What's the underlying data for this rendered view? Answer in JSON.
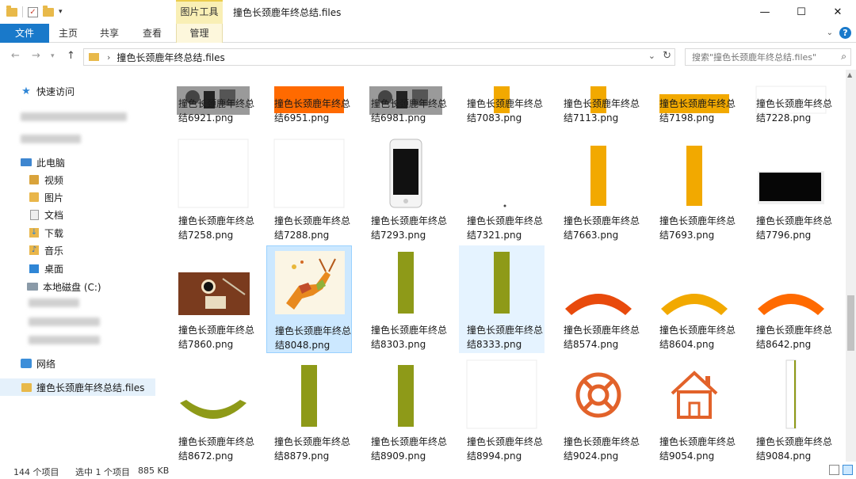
{
  "window": {
    "context_tab": "图片工具",
    "title": "撞色长颈鹿年终总结.files"
  },
  "ribbon": {
    "tabs": [
      "文件",
      "主页",
      "共享",
      "查看",
      "管理"
    ]
  },
  "address": {
    "crumb": "撞色长颈鹿年终总结.files",
    "search_placeholder": "搜索\"撞色长颈鹿年终总结.files\""
  },
  "sidebar": {
    "quick_access": "快速访问",
    "this_pc": "此电脑",
    "pc_items": [
      "视频",
      "图片",
      "文档",
      "下载",
      "音乐",
      "桌面",
      "本地磁盘 (C:)"
    ],
    "network": "网络",
    "current_folder": "撞色长颈鹿年终总结.files"
  },
  "files": {
    "name_prefix": "撞色长颈鹿年终总",
    "rows": [
      [
        "结6921.png",
        "结6951.png",
        "结6981.png",
        "结7083.png",
        "结7113.png",
        "结7198.png",
        "结7228.png"
      ],
      [
        "结7258.png",
        "结7288.png",
        "结7293.png",
        "结7321.png",
        "结7663.png",
        "结7693.png",
        "结7796.png"
      ],
      [
        "结7860.png",
        "结8048.png",
        "结8303.png",
        "结8333.png",
        "结8574.png",
        "结8604.png",
        "结8642.png"
      ],
      [
        "结8672.png",
        "结8879.png",
        "结8909.png",
        "结8994.png",
        "结9024.png",
        "结9054.png",
        "结9084.png"
      ]
    ],
    "selected": "结8048.png",
    "highlighted": "结8333.png"
  },
  "status": {
    "count": "144 个项目",
    "selected": "选中 1 个项目",
    "size": "885 KB"
  },
  "colors": {
    "accent": "#1979ca",
    "orange": "#ff6a00",
    "yellow": "#f2a900",
    "olive": "#8e9a18",
    "icon_orange": "#e2622a"
  }
}
